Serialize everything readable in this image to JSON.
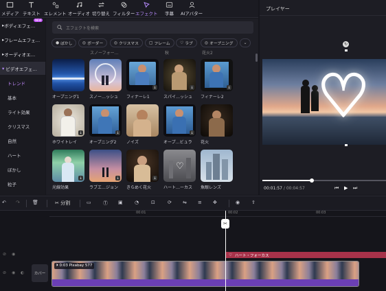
{
  "toolbar": {
    "tools": [
      {
        "label": "メディア",
        "icon": "media-icon"
      },
      {
        "label": "テキスト",
        "icon": "text-icon"
      },
      {
        "label": "エレメント",
        "icon": "elements-icon"
      },
      {
        "label": "オーディオ",
        "icon": "audio-icon"
      },
      {
        "label": "切り替え",
        "icon": "transition-icon"
      },
      {
        "label": "フィルター",
        "icon": "filter-icon"
      },
      {
        "label": "エフェクト",
        "icon": "effects-icon"
      },
      {
        "label": "字幕",
        "icon": "subtitle-icon"
      },
      {
        "label": "AIアバター",
        "icon": "ai-avatar-icon"
      }
    ]
  },
  "sidebar": {
    "categories": [
      "ボディエフェ…",
      "フレームエフェ…",
      "オーディオエ…",
      "ビデオエフェ…"
    ],
    "new_badge": "NEW",
    "subcategories": [
      "トレンド",
      "基本",
      "ライト効果",
      "クリスマス",
      "自然",
      "ハート",
      "ぼかし",
      "粒子"
    ]
  },
  "search": {
    "placeholder": "エフェクトを検索"
  },
  "chips": [
    "ぼかし",
    "ボーダー",
    "クリスマス",
    "フレーム",
    "ラブ",
    "オープニング"
  ],
  "partial_labels": [
    "",
    "スノーフォー…",
    "",
    "秋",
    "",
    "花火2"
  ],
  "effects": [
    {
      "label": "オープニング1"
    },
    {
      "label": "スノー…ッシュ"
    },
    {
      "label": "フィナーレ1"
    },
    {
      "label": "スパイ…ッシュ"
    },
    {
      "label": "フィナーレ2"
    },
    {
      "label": "ホワイトレイ"
    },
    {
      "label": "オープニング2"
    },
    {
      "label": "ノイズ"
    },
    {
      "label": "オープ…ビュラ"
    },
    {
      "label": "花火"
    },
    {
      "label": "光線効果"
    },
    {
      "label": "ラブエ…ジョン"
    },
    {
      "label": "きらめく花火"
    },
    {
      "label": "ハート…ーカス"
    },
    {
      "label": "魚眼レンズ"
    }
  ],
  "player": {
    "title": "プレイヤー",
    "current_time": "00:01:57",
    "separator": "/",
    "total_time": "00:04:57",
    "progress": 0.4
  },
  "edit_toolbar": {
    "split_label": "分割"
  },
  "timeline": {
    "ruler": [
      "00:01",
      "00:02",
      "00:03"
    ],
    "effect_clip_label": "ハート・フォーカス",
    "cover_label": "カバー",
    "video_clip_label": "0:03 Pixabay 577"
  },
  "colors": {
    "accent": "#b98cff",
    "effect_track": "#a8324a",
    "audio_track": "#6b3fb5",
    "sel_badge": "#c44dff"
  }
}
